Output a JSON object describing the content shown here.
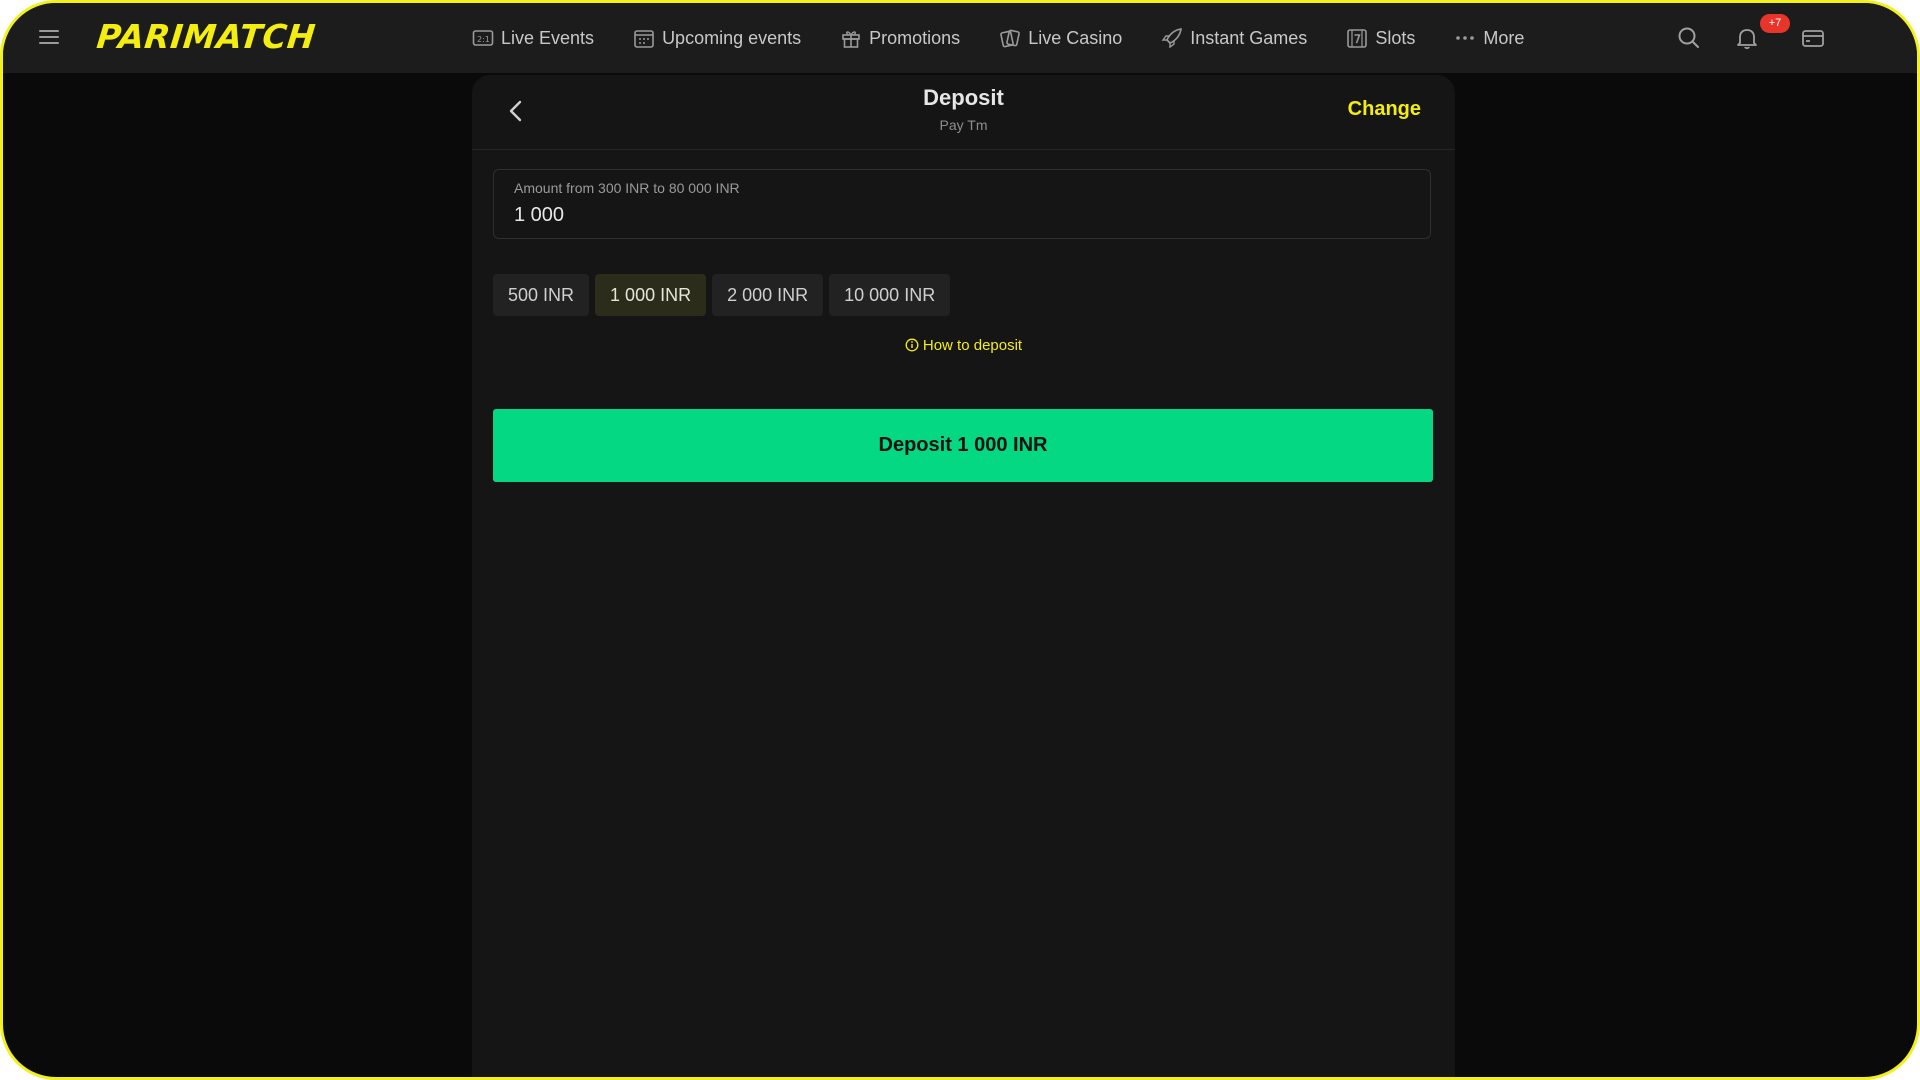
{
  "header": {
    "logo_text": "PARIMATCH",
    "menu_icon": "hamburger-menu-icon",
    "nav": [
      {
        "label": "Live Events",
        "icon": "scoreboard-icon"
      },
      {
        "label": "Upcoming events",
        "icon": "calendar-icon"
      },
      {
        "label": "Promotions",
        "icon": "gift-icon"
      },
      {
        "label": "Live Casino",
        "icon": "cards-icon"
      },
      {
        "label": "Instant Games",
        "icon": "rocket-icon"
      },
      {
        "label": "Slots",
        "icon": "slot-seven-icon"
      },
      {
        "label": "More",
        "icon": "ellipsis-icon"
      }
    ],
    "notification_badge": "+7",
    "search_icon": "search-icon",
    "bell_icon": "bell-icon",
    "wallet_icon": "wallet-icon"
  },
  "deposit": {
    "title": "Deposit",
    "subtitle": "Pay Tm",
    "change_label": "Change",
    "amount_label": "Amount from 300 INR to 80 000 INR",
    "amount_value": "1 000",
    "chips": [
      "500 INR",
      "1 000 INR",
      "2 000 INR",
      "10 000 INR"
    ],
    "selected_chip": "1 000 INR",
    "how_to_label": "How to deposit",
    "submit_label": "Deposit 1 000 INR"
  },
  "colors": {
    "brand_yellow": "#f4ee10",
    "deposit_green": "#04d882",
    "badge_red": "#e8352a",
    "header_bg": "#1c1c1c",
    "panel_bg": "#151515"
  }
}
